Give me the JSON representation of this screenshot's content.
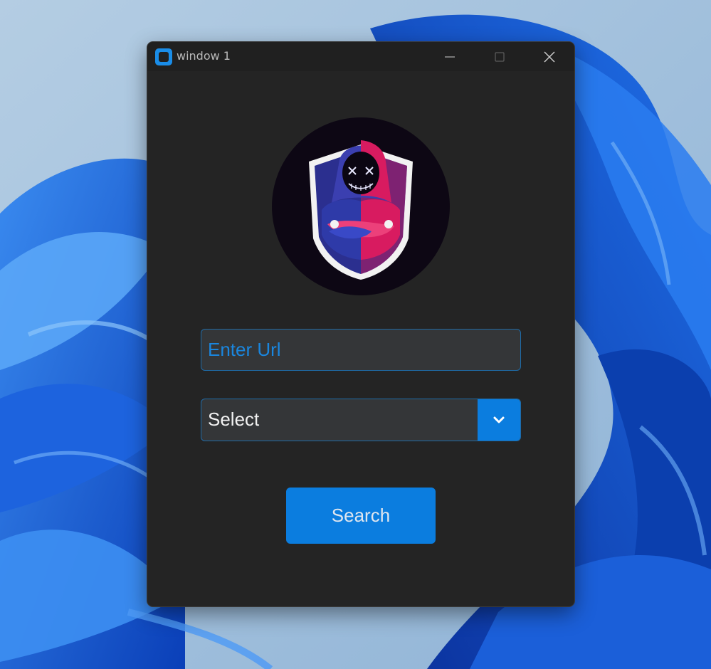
{
  "window": {
    "title": "window 1",
    "controls": {
      "minimize": "minimize-icon",
      "maximize": "maximize-icon",
      "close": "close-icon"
    }
  },
  "logo": {
    "icon": "hooded-figure-logo"
  },
  "form": {
    "url_placeholder": "Enter Url",
    "url_value": "",
    "select_value": "Select",
    "search_label": "Search"
  },
  "colors": {
    "accent": "#0b7ddf",
    "window_bg": "#242424",
    "titlebar_bg": "#202020",
    "field_bg": "#343638",
    "field_border": "#1f6aa5"
  }
}
